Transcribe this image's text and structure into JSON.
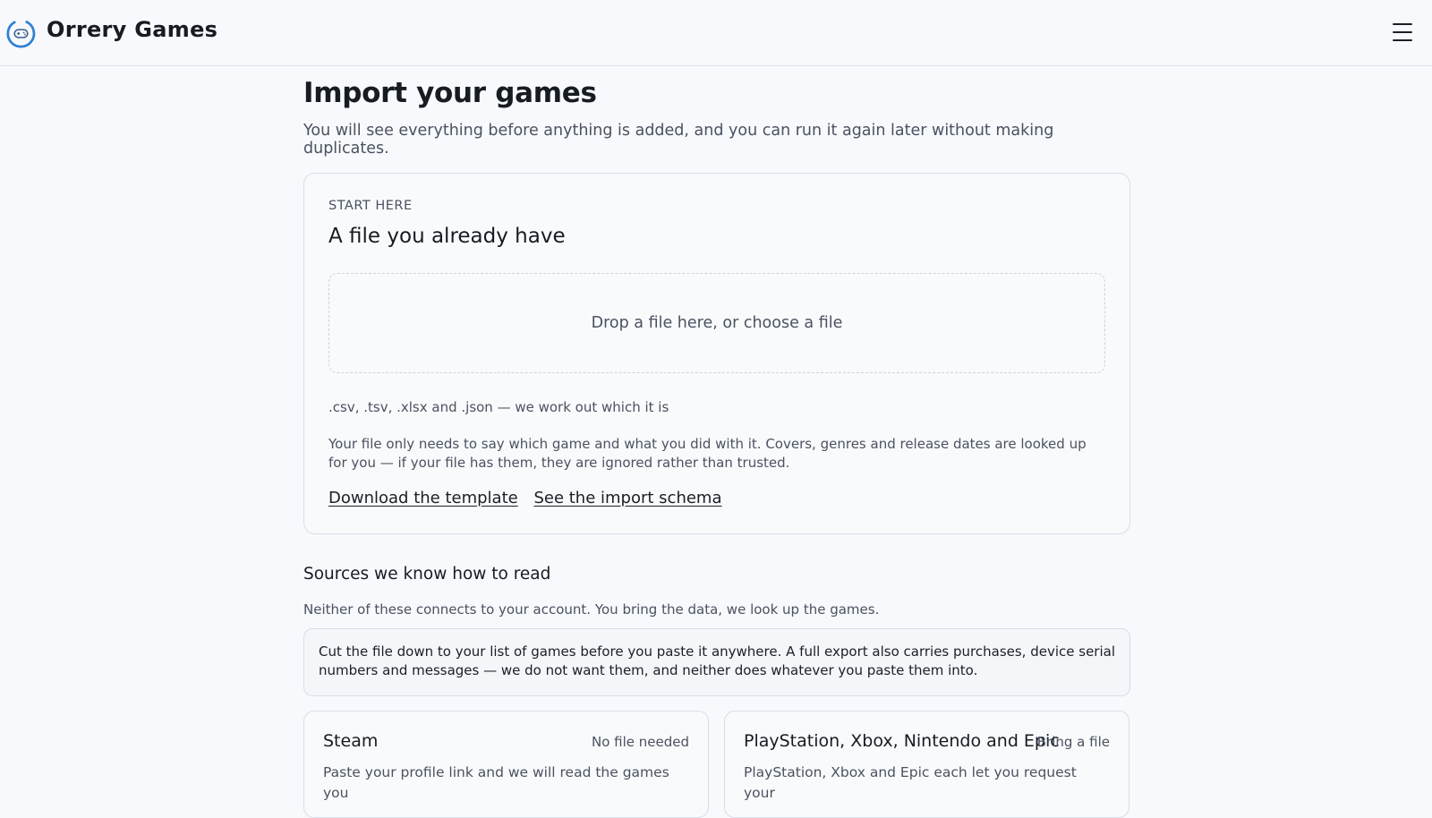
{
  "header": {
    "brand": "Orrery Games"
  },
  "page": {
    "title": "Import your games",
    "lede": "You will see everything before anything is added, and you can run it again later without making duplicates."
  },
  "start_card": {
    "eyebrow": "START HERE",
    "title": "A file you already have",
    "dropzone_label": "Drop a file here, or choose a file",
    "formats": ".csv, .tsv, .xlsx and .json — we work out which it is",
    "explain": "Your file only needs to say which game and what you did with it. Covers, genres and release dates are looked up for you — if your file has them, they are ignored rather than trusted.",
    "template_link": "Download the template",
    "schema_link": "See the import schema"
  },
  "sources": {
    "title": "Sources we know how to read",
    "subtitle": "Neither of these connects to your account. You bring the data, we look up the games.",
    "notice": "Cut the file down to your list of games before you paste it anywhere. A full export also carries purchases, device serial numbers and messages — we do not want them, and neither does whatever you paste them into.",
    "cards": [
      {
        "name": "Steam",
        "badge": "No file needed",
        "description": "Paste your profile link and we will read the games you"
      },
      {
        "name": "PlayStation, Xbox, Nintendo and Epic",
        "badge": "Bring a file",
        "description": "PlayStation, Xbox and Epic each let you request your"
      }
    ]
  },
  "colors": {
    "background": "#f7f9fc",
    "logo_blue": "#2f7fd6",
    "text_primary": "#171b22",
    "text_muted": "#4a5260",
    "border": "#d9dee6"
  },
  "icons": {
    "logo": "gamepad-orbit-icon",
    "menu": "hamburger-menu-icon"
  }
}
